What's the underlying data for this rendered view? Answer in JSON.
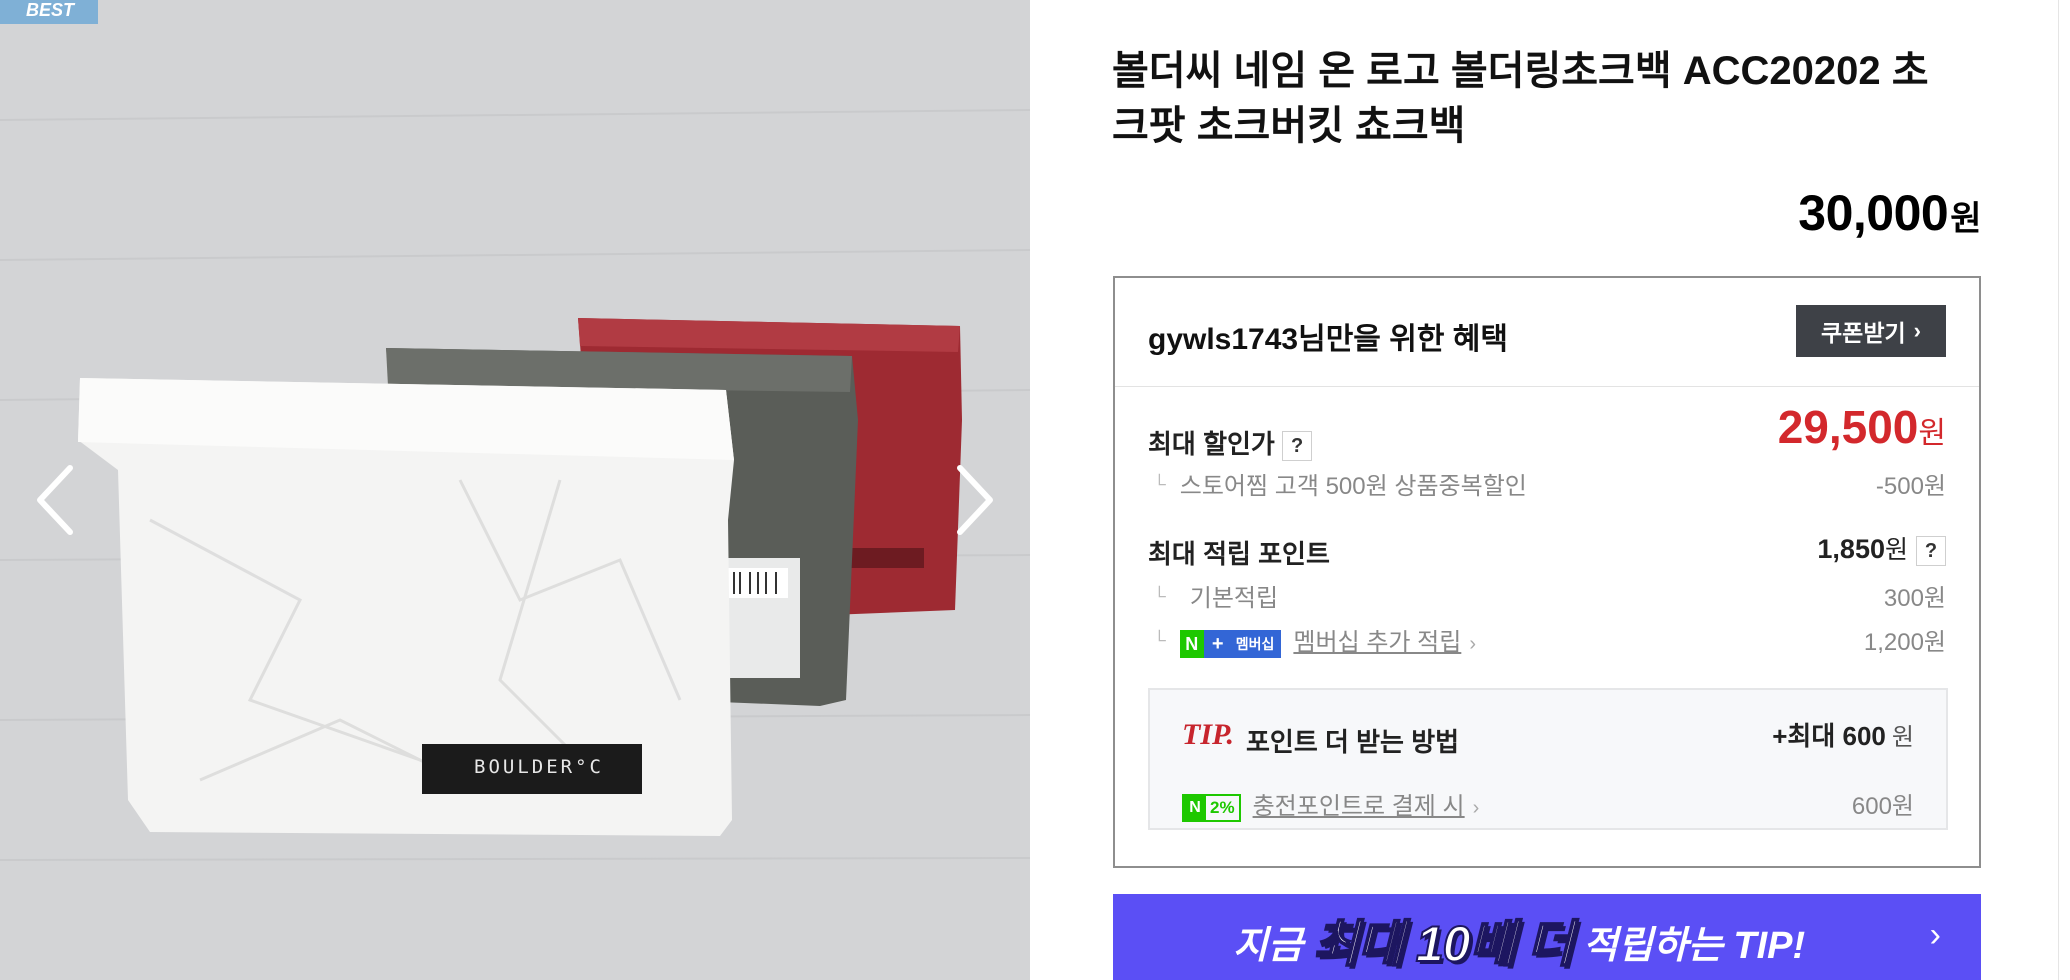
{
  "gallery": {
    "badge": "BEST",
    "photo_logo": "BOULDER°C",
    "bag_colors": [
      "#f4f4f3",
      "#5a5d58",
      "#9e2a32"
    ]
  },
  "product": {
    "title": "볼더씨 네임 온 로고 볼더링초크백 ACC20202 초크팟 초크버킷 쵸크백",
    "price": "30,000",
    "price_unit": "원"
  },
  "benefit": {
    "title": "gywls1743님만을 위한 혜택",
    "coupon_label": "쿠폰받기",
    "max_discount_label": "최대 할인가",
    "help_mark": "?",
    "sale_price": "29,500",
    "sale_unit": "원",
    "discount_detail": "스토어찜 고객 500원 상품중복할인",
    "discount_amount": "-500원",
    "max_points_label": "최대 적립 포인트",
    "max_points_value": "1,850",
    "points_unit": "원",
    "base_points_label": "기본적립",
    "base_points_value": "300원",
    "membership_badge_n": "N",
    "membership_badge_plus": "+",
    "membership_badge_text": "멤버십",
    "membership_label": "멤버십 추가 적립",
    "membership_value": "1,200원"
  },
  "tip": {
    "mark": "TIP.",
    "title": "포인트 더 받는 방법",
    "max_prefix": "+최대",
    "max_value": "600",
    "max_unit": "원",
    "charge_badge_n": "N",
    "charge_badge_pct": "2%",
    "charge_label": "충전포인트로 결제 시",
    "charge_value": "600원"
  },
  "banner": {
    "part1": "지금",
    "part2": "최대 10배 더",
    "part3": "적립하는 TIP!"
  },
  "colors": {
    "sale_red": "#d3282c",
    "banner_purple": "#5b4ff5",
    "naver_green": "#1ec800",
    "membership_blue": "#3366d6"
  }
}
